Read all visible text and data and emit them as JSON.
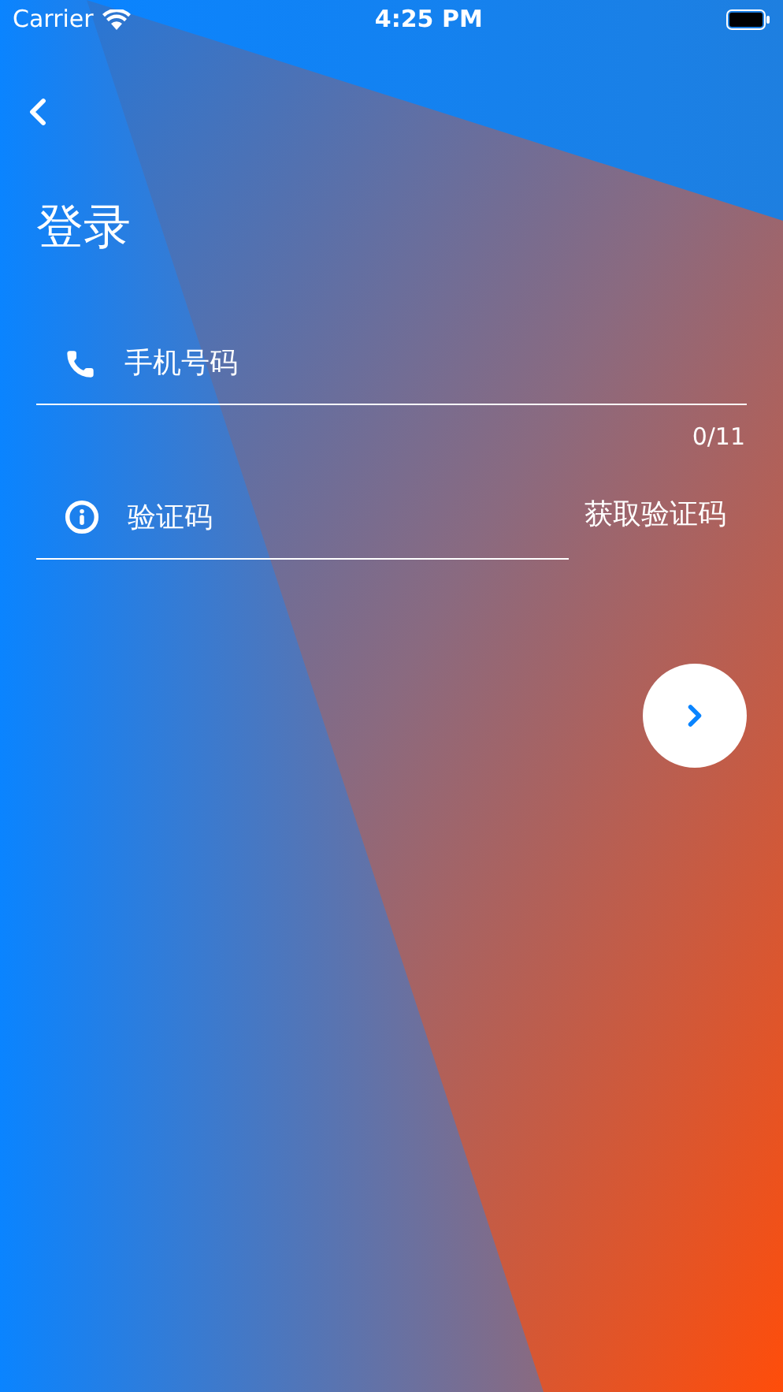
{
  "status_bar": {
    "carrier": "Carrier",
    "time": "4:25 PM"
  },
  "title": "登录",
  "phone_field": {
    "placeholder": "手机号码",
    "counter": "0/11"
  },
  "code_field": {
    "placeholder": "验证码",
    "get_code_button": "获取验证码"
  }
}
